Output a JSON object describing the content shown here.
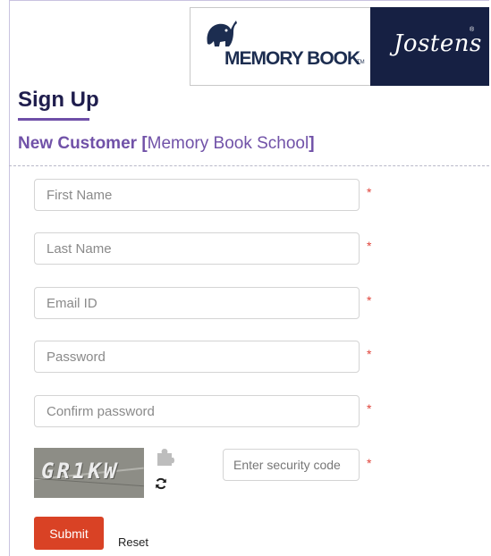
{
  "header": {
    "memory_book_logo_text": "MEMORY BOOK",
    "jostens_logo_text": "Jostens",
    "brand_navy": "#162043"
  },
  "page_title": "Sign Up",
  "subtitle": {
    "label": "New Customer",
    "bracket_open": "[",
    "school": "Memory Book School",
    "bracket_close": "]"
  },
  "form": {
    "first_name": {
      "placeholder": "First Name",
      "value": ""
    },
    "last_name": {
      "placeholder": "Last Name",
      "value": ""
    },
    "email": {
      "placeholder": "Email ID",
      "value": ""
    },
    "password": {
      "placeholder": "Password",
      "value": ""
    },
    "confirm_password": {
      "placeholder": "Confirm password",
      "value": ""
    },
    "required_marker": "*",
    "captcha": {
      "image_text": "GR1KW",
      "puzzle_icon": "puzzle-piece-icon",
      "refresh_icon": "refresh-icon"
    },
    "security_code": {
      "placeholder": "Enter security code",
      "value": ""
    }
  },
  "buttons": {
    "submit": "Submit",
    "reset": "Reset",
    "submit_color": "#d94225"
  },
  "colors": {
    "title": "#1f1d4d",
    "accent_purple": "#7152a8",
    "required_red": "#e0453b"
  }
}
